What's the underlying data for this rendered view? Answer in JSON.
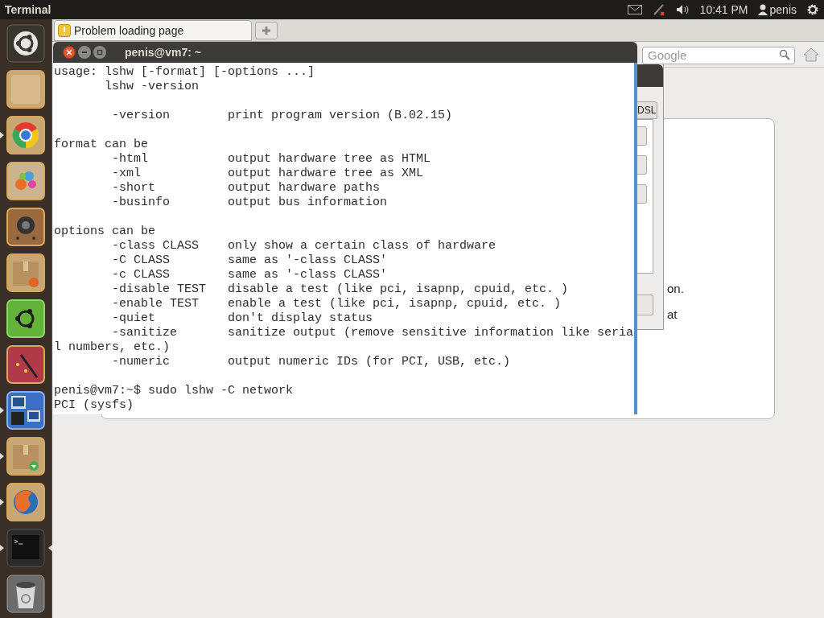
{
  "top_panel": {
    "app_title": "Terminal",
    "clock": "10:41 PM",
    "user": "penis"
  },
  "launcher": [
    {
      "running": false,
      "focused": false
    },
    {
      "running": false,
      "focused": false
    },
    {
      "running": true,
      "focused": false
    },
    {
      "running": false,
      "focused": false
    },
    {
      "running": false,
      "focused": false
    },
    {
      "running": false,
      "focused": false
    },
    {
      "running": false,
      "focused": false
    },
    {
      "running": false,
      "focused": false
    },
    {
      "running": true,
      "focused": false
    },
    {
      "running": true,
      "focused": false
    },
    {
      "running": true,
      "focused": false
    },
    {
      "running": true,
      "focused": true
    },
    {
      "running": false,
      "focused": false
    }
  ],
  "browser": {
    "tabs": [
      {
        "label": "Problem loading page",
        "selected": true
      }
    ],
    "search": {
      "placeholder": "Google"
    },
    "error_texts": [
      "on.",
      "at"
    ]
  },
  "dialog": {
    "tab": "DSL"
  },
  "terminal": {
    "title": "penis@vm7: ~",
    "blocks": [
      [
        "usage: lshw [-format] [-options ...]",
        "       lshw -version"
      ],
      [
        "        -version        print program version (B.02.15)"
      ],
      [
        "format can be",
        "        -html           output hardware tree as HTML",
        "        -xml            output hardware tree as XML",
        "        -short          output hardware paths",
        "        -businfo        output bus information"
      ],
      [
        "options can be",
        "        -class CLASS    only show a certain class of hardware",
        "        -C CLASS        same as '-class CLASS'",
        "        -c CLASS        same as '-class CLASS'",
        "        -disable TEST   disable a test (like pci, isapnp, cpuid, etc. )",
        "        -enable TEST    enable a test (like pci, isapnp, cpuid, etc. )",
        "        -quiet          don't display status",
        "        -sanitize       sanitize output (remove sensitive information like seria",
        "l numbers, etc.)",
        "        -numeric        output numeric IDs (for PCI, USB, etc.)"
      ],
      [
        "penis@vm7:~$ sudo lshw -C network",
        "PCI (sysfs)"
      ]
    ]
  }
}
